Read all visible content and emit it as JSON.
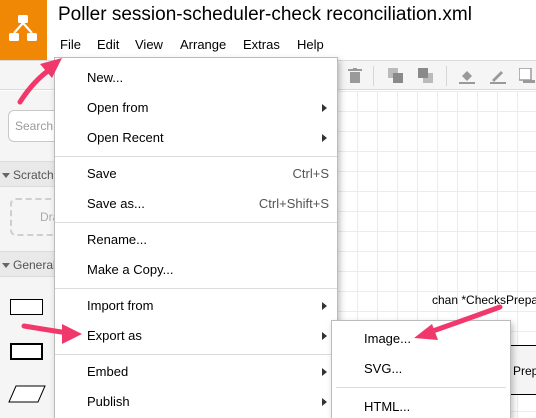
{
  "app": {
    "title": "Poller session-scheduler-check reconciliation.xml",
    "brand_color": "#f08705",
    "logo_icon": "drawio-diagram-icon"
  },
  "menubar": {
    "items": [
      "File",
      "Edit",
      "View",
      "Arrange",
      "Extras",
      "Help"
    ]
  },
  "sidebar": {
    "search_placeholder": "Search",
    "scratchpad_label": "Scratchpad",
    "scratchpad_drop": "Drag",
    "general_label": "General",
    "section_icon": "triangle-down-icon"
  },
  "canvas": {
    "label_text": "chan *ChecksPrepa",
    "box_text": "Prep"
  },
  "file_menu": {
    "items": [
      {
        "label": "New...",
        "shortcut": "",
        "submenu": false
      },
      {
        "label": "Open from",
        "shortcut": "",
        "submenu": true
      },
      {
        "label": "Open Recent",
        "shortcut": "",
        "submenu": true
      },
      {
        "label": "Save",
        "shortcut": "Ctrl+S",
        "submenu": false
      },
      {
        "label": "Save as...",
        "shortcut": "Ctrl+Shift+S",
        "submenu": false
      },
      {
        "label": "Rename...",
        "shortcut": "",
        "submenu": false
      },
      {
        "label": "Make a Copy...",
        "shortcut": "",
        "submenu": false
      },
      {
        "label": "Import from",
        "shortcut": "",
        "submenu": true
      },
      {
        "label": "Export as",
        "shortcut": "",
        "submenu": true
      },
      {
        "label": "Embed",
        "shortcut": "",
        "submenu": true
      },
      {
        "label": "Publish",
        "shortcut": "",
        "submenu": true
      }
    ]
  },
  "export_submenu": {
    "items": [
      "Image...",
      "SVG...",
      "HTML..."
    ]
  },
  "annotation": {
    "arrow_color": "#f0386b"
  }
}
